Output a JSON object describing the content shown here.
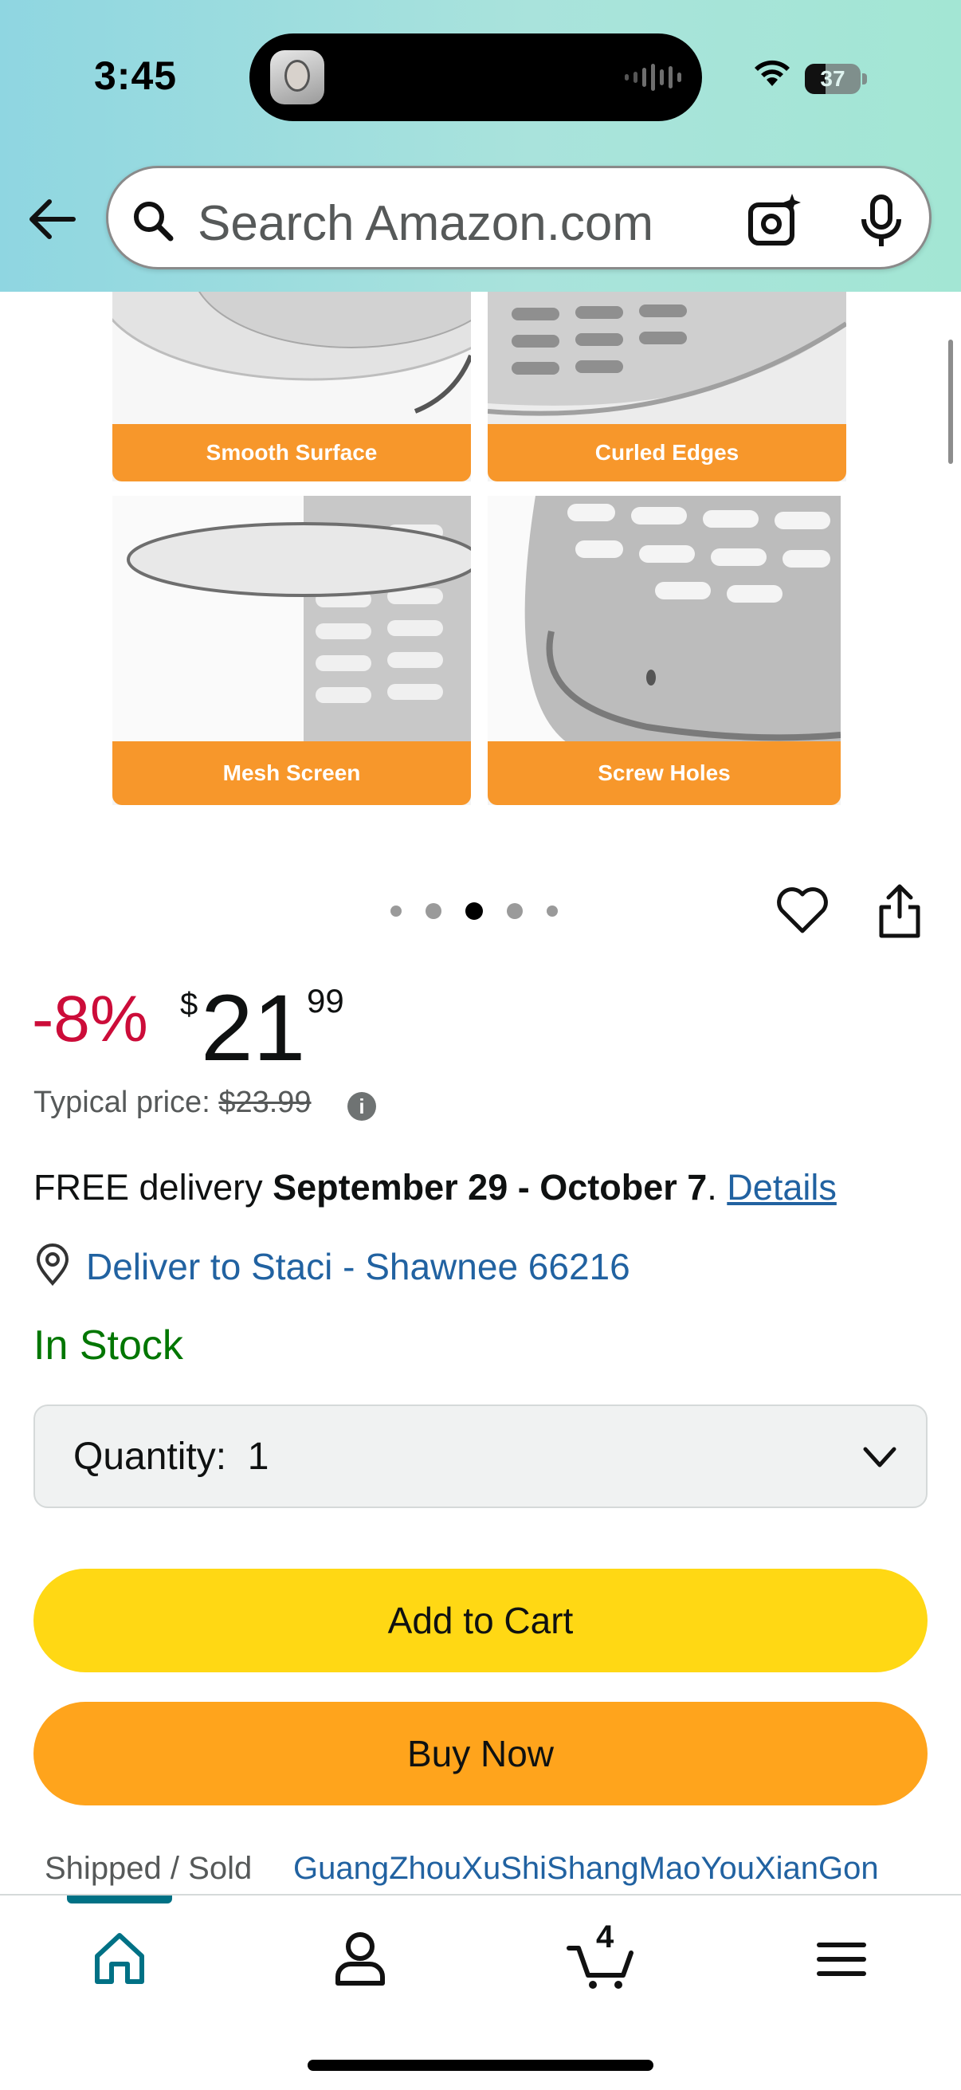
{
  "status_bar": {
    "time": "3:45",
    "battery": "37",
    "battery_level": 0.37
  },
  "search": {
    "placeholder": "Search Amazon.com"
  },
  "gallery": {
    "tiles": [
      {
        "label": "Smooth Surface"
      },
      {
        "label": "Curled Edges"
      },
      {
        "label": "Mesh Screen"
      },
      {
        "label": "Screw Holes"
      }
    ],
    "total_images": 5,
    "active_index": 2
  },
  "price": {
    "discount": "-8%",
    "currency_symbol": "$",
    "whole": "21",
    "fraction": "99",
    "typical_label": "Typical price: ",
    "typical_value": "$23.99"
  },
  "delivery": {
    "prefix": "FREE delivery ",
    "dates": "September 29 - October 7",
    "suffix": ". ",
    "details_link": "Details",
    "deliver_to": "Deliver to Staci - Shawnee 66216",
    "stock": "In Stock"
  },
  "quantity": {
    "label": "Quantity:  1"
  },
  "buttons": {
    "add_to_cart": "Add to Cart",
    "buy_now": "Buy Now"
  },
  "seller": {
    "label": "Shipped / Sold",
    "name": "GuangZhouXuShiShangMaoYouXianGon"
  },
  "bottom_nav": {
    "cart_count": "4",
    "active_tab": "home"
  },
  "colors": {
    "discount": "#cc0c39",
    "link": "#2162a1",
    "in_stock": "#007600",
    "add_to_cart": "#ffd814",
    "buy_now": "#ffa41c",
    "tile_label": "#f7972b",
    "nav_active": "#007185"
  }
}
